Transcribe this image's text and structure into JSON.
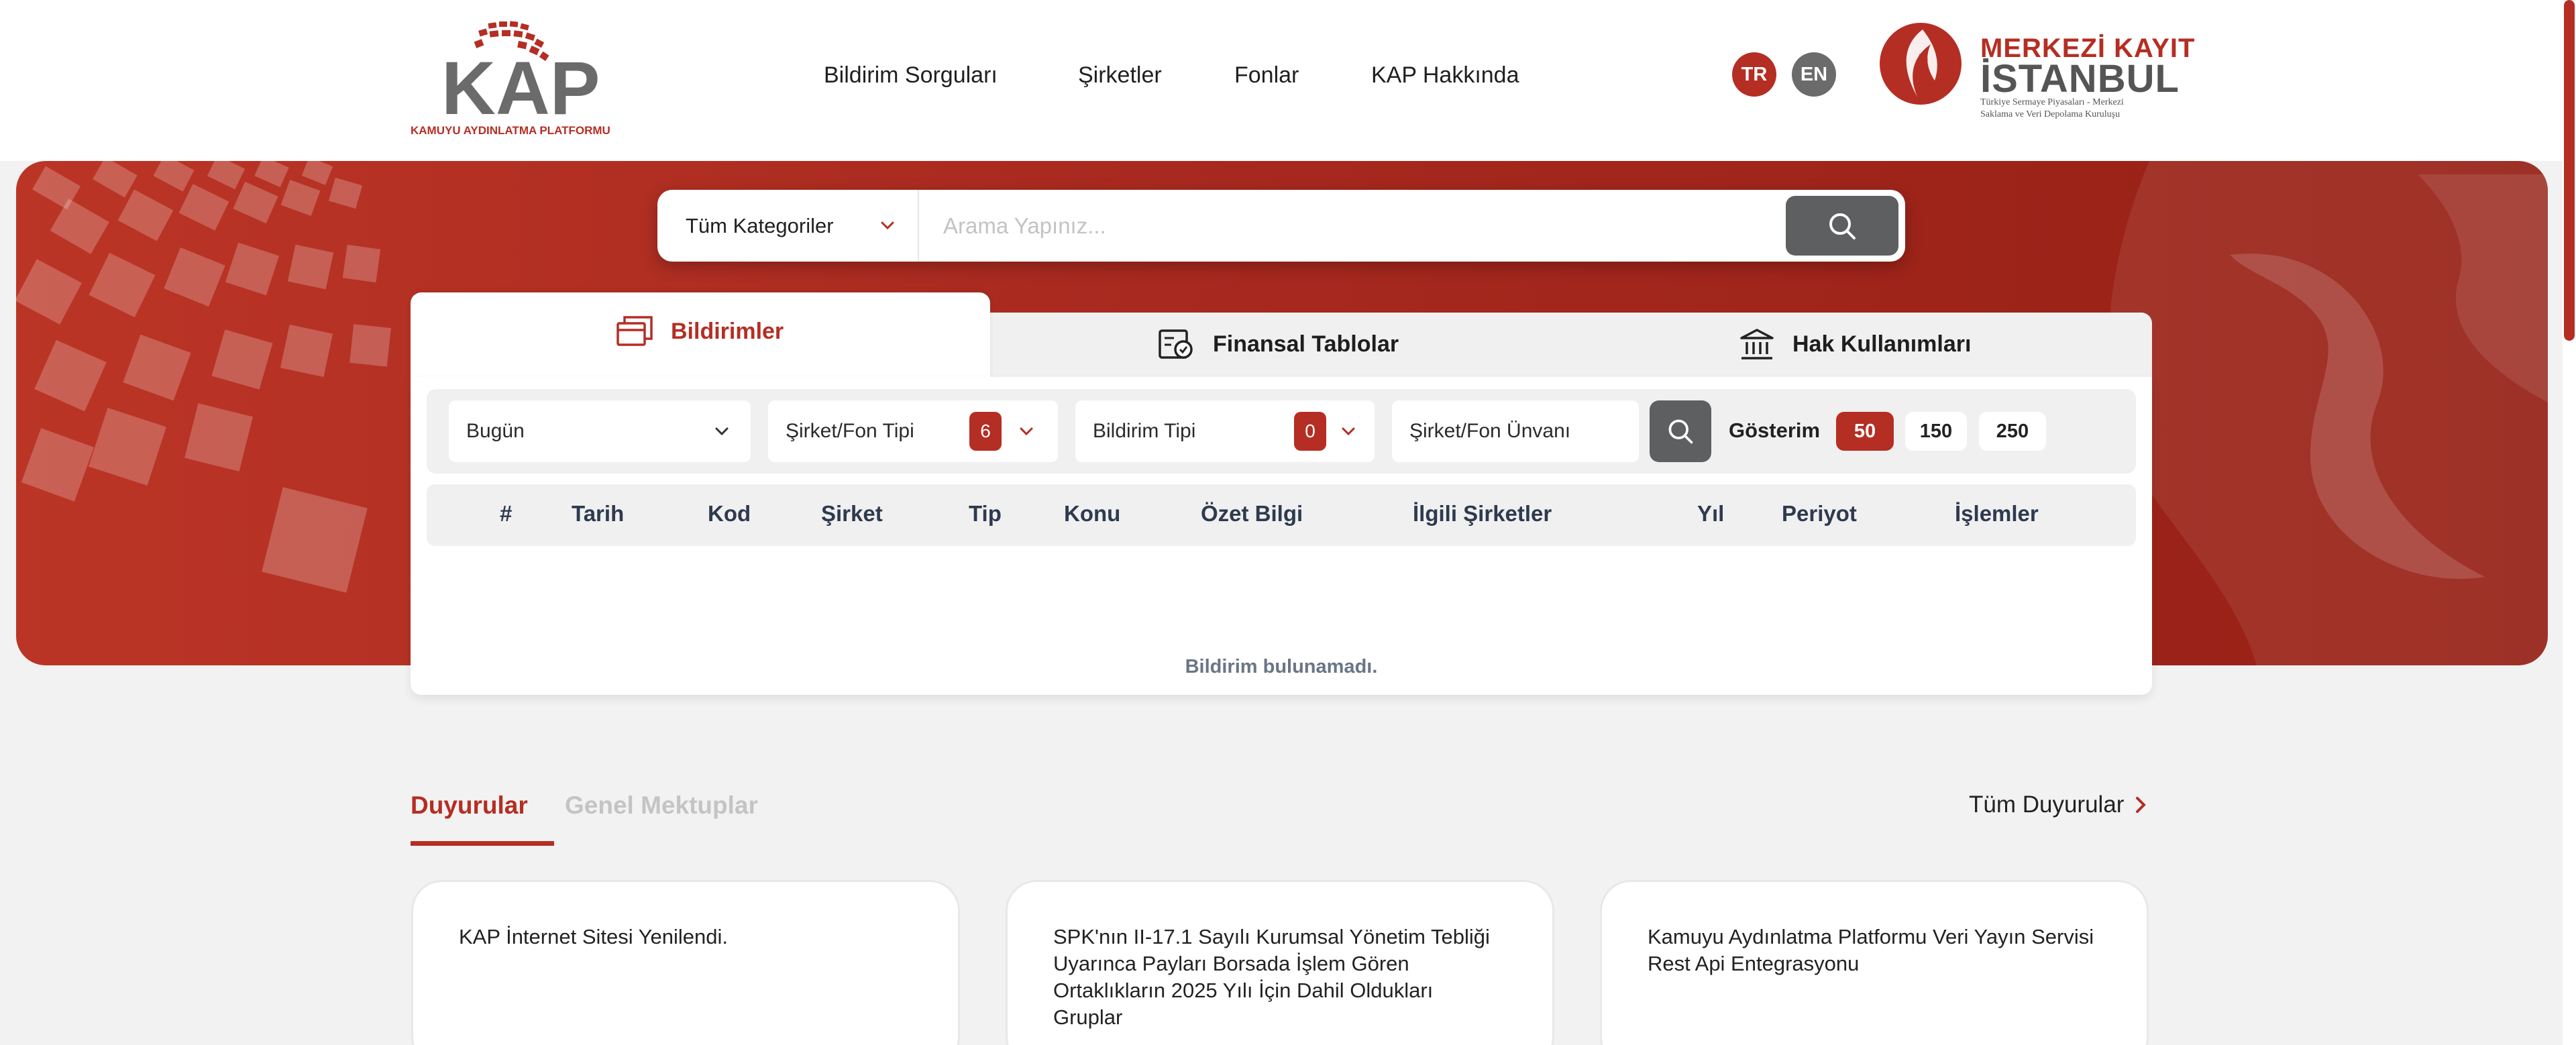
{
  "header": {
    "logo": {
      "main": "KAP",
      "subtitle": "KAMUYU AYDINLATMA PLATFORMU"
    },
    "nav": [
      "Bildirim Sorguları",
      "Şirketler",
      "Fonlar",
      "KAP Hakkında"
    ],
    "languages": [
      {
        "code": "TR",
        "color": "#b52e23"
      },
      {
        "code": "EN",
        "color": "#6b6b6b"
      }
    ],
    "partner_logo": {
      "line1": "MERKEZİ KAYIT",
      "line2": "İSTANBUL",
      "line3": "Türkiye Sermaye Piyasaları - Merkezi",
      "line4": "Saklama ve Veri Depolama Kuruluşu"
    }
  },
  "search": {
    "category": "Tüm Kategoriler",
    "placeholder": "Arama Yapınız..."
  },
  "tabs": [
    {
      "label": "Bildirimler",
      "icon": "window-icon",
      "active": true
    },
    {
      "label": "Finansal Tablolar",
      "icon": "financial-report-icon",
      "active": false
    },
    {
      "label": "Hak Kullanımları",
      "icon": "bank-icon",
      "active": false
    }
  ],
  "filters": {
    "date": "Bugün",
    "company_type": {
      "label": "Şirket/Fon Tipi",
      "count": "6"
    },
    "notice_type": {
      "label": "Bildirim Tipi",
      "count": "0"
    },
    "name_placeholder": "Şirket/Fon Ünvanı",
    "show_label": "Gösterim",
    "show_options": [
      {
        "value": "50",
        "selected": true
      },
      {
        "value": "150",
        "selected": false
      },
      {
        "value": "250",
        "selected": false
      }
    ]
  },
  "table": {
    "columns": [
      "#",
      "Tarih",
      "Kod",
      "Şirket",
      "Tip",
      "Konu",
      "Özet Bilgi",
      "İlgili Şirketler",
      "Yıl",
      "Periyot",
      "İşlemler"
    ],
    "rows": [],
    "empty_message": "Bildirim bulunamadı."
  },
  "announcements": {
    "tabs": [
      {
        "label": "Duyurular",
        "active": true
      },
      {
        "label": "Genel Mektuplar",
        "active": false
      }
    ],
    "all_link": "Tüm Duyurular",
    "cards": [
      {
        "text": "KAP İnternet Sitesi Yenilendi."
      },
      {
        "text": "SPK'nın II-17.1 Sayılı Kurumsal Yönetim Tebliği Uyarınca Payları Borsada İşlem Gören Ortaklıkların 2025 Yılı İçin Dahil Oldukları Gruplar"
      },
      {
        "text": "Kamuyu Aydınlatma Platformu Veri Yayın Servisi Rest Api Entegrasyonu"
      }
    ]
  },
  "colors": {
    "brand": "#b52e23",
    "dark_button": "#5d5f61",
    "panel_bg": "#f0f0f0"
  }
}
